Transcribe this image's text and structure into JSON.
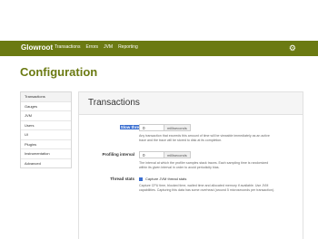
{
  "header": {
    "brand": "Glowroot",
    "nav": [
      "Transactions",
      "Errors",
      "JVM",
      "Reporting"
    ],
    "settings_icon": "gear-icon"
  },
  "page_title": "Configuration",
  "sidebar": {
    "items": [
      "Transactions",
      "Gauges",
      "JVM",
      "Users",
      "UI",
      "Plugins",
      "Instrumentation",
      "Advanced"
    ],
    "active": "Transactions"
  },
  "panel": {
    "title": "Transactions",
    "slow_threshold": {
      "label": "Slow threshold",
      "value": "0",
      "unit": "milliseconds",
      "help_line1": "Any transaction that exceeds this amount of time will be viewable immediately as an active",
      "help_line2": "trace and the trace will be stored to disk at its completion."
    },
    "profiling_interval": {
      "label": "Profiling interval",
      "value": "0",
      "unit": "milliseconds",
      "help_line1": "The interval at which the profiler samples stack traces. Each sampling time is randomized",
      "help_line2": "within its given interval in order to avoid periodicity bias."
    },
    "thread_stats": {
      "label": "Thread stats",
      "checkbox_label": "Capture JVM thread stats",
      "checked": true,
      "help_line1": "Capture CPU time, blocked time, waited time and allocated memory if available. Use JVM",
      "help_line2": "capabilities. Capturing this data has some overhead (around 5 microseconds per transaction)."
    }
  }
}
